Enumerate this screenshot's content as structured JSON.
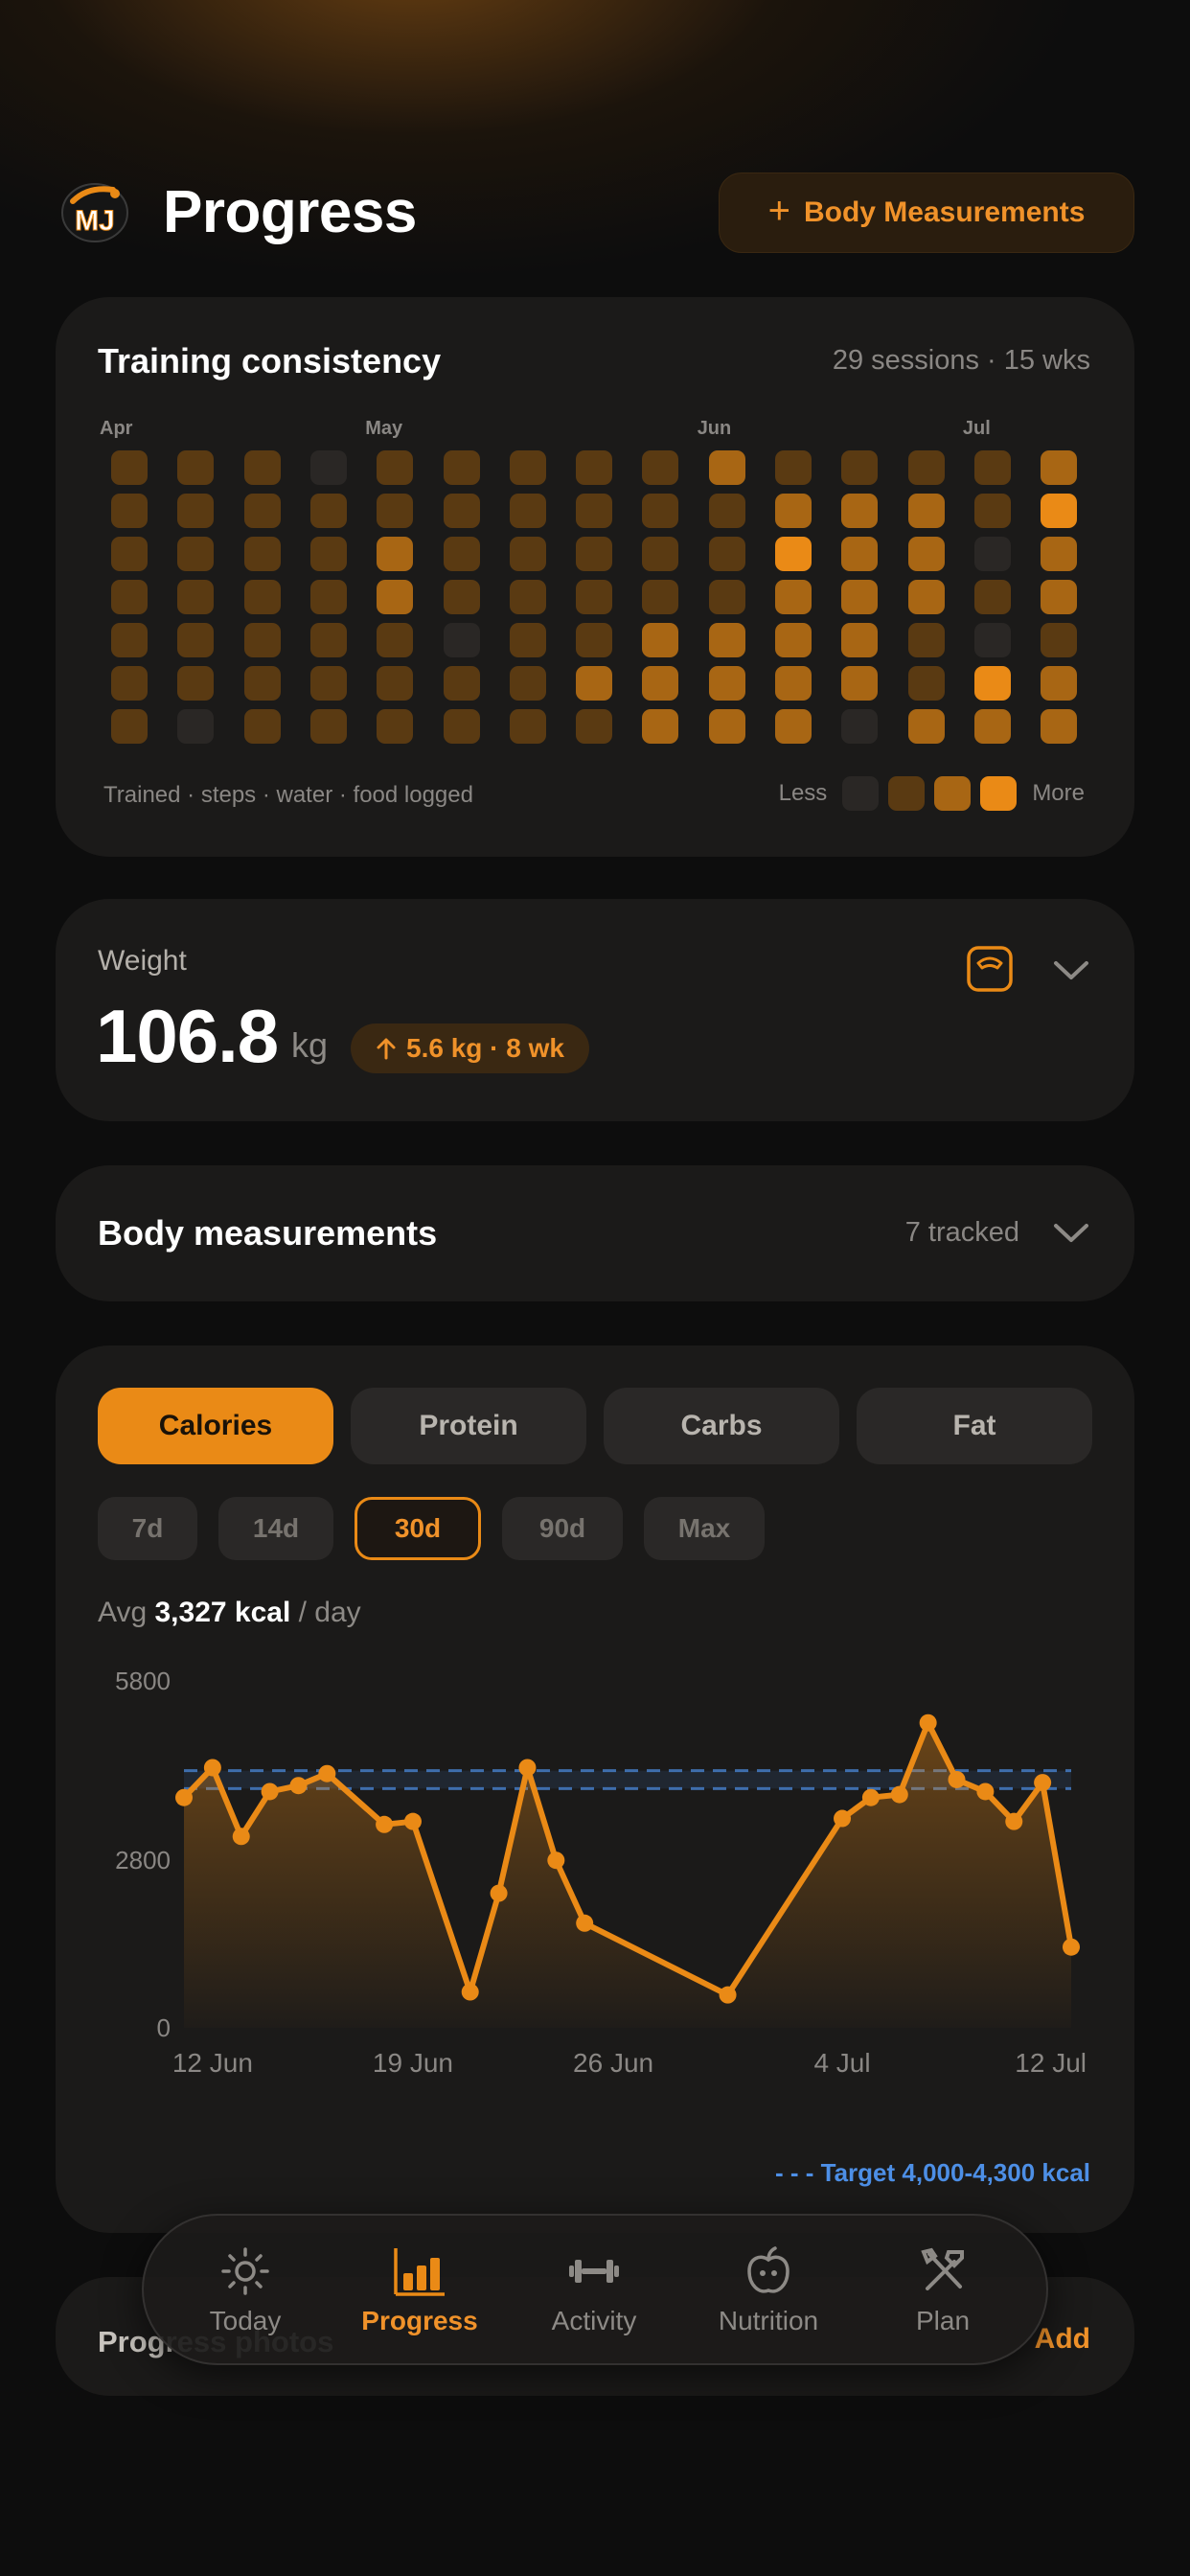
{
  "header": {
    "title": "Progress",
    "add_button_label": "Body Measurements",
    "add_button_icon": "plus-icon",
    "logo_text": "MJ"
  },
  "colors": {
    "accent": "#EA8A16",
    "background": "#0D0D0D",
    "card": "#1B1A19",
    "target_line": "#4D8FE6"
  },
  "training": {
    "title": "Training consistency",
    "meta": "29 sessions · 15 wks",
    "months": [
      {
        "label": "Apr",
        "week": 0
      },
      {
        "label": "May",
        "week": 4
      },
      {
        "label": "Jun",
        "week": 9
      },
      {
        "label": "Jul",
        "week": 13
      }
    ],
    "grid_levels": [
      [
        1,
        1,
        1,
        1,
        1,
        1,
        1
      ],
      [
        1,
        1,
        1,
        1,
        1,
        1,
        0
      ],
      [
        1,
        1,
        1,
        1,
        1,
        1,
        1
      ],
      [
        0,
        1,
        1,
        1,
        1,
        1,
        1
      ],
      [
        1,
        1,
        2,
        2,
        1,
        1,
        1
      ],
      [
        1,
        1,
        1,
        1,
        0,
        1,
        1
      ],
      [
        1,
        1,
        1,
        1,
        1,
        1,
        1
      ],
      [
        1,
        1,
        1,
        1,
        1,
        2,
        1
      ],
      [
        1,
        1,
        1,
        1,
        2,
        2,
        2
      ],
      [
        2,
        1,
        1,
        1,
        2,
        2,
        2
      ],
      [
        1,
        2,
        3,
        2,
        2,
        2,
        2
      ],
      [
        1,
        2,
        2,
        2,
        2,
        2,
        0
      ],
      [
        1,
        2,
        2,
        2,
        1,
        1,
        2
      ],
      [
        1,
        1,
        0,
        1,
        0,
        3,
        2
      ],
      [
        2,
        3,
        2,
        2,
        1,
        2,
        2
      ]
    ],
    "legend_caption": "Trained · steps · water · food logged",
    "legend_less": "Less",
    "legend_more": "More"
  },
  "weight": {
    "label": "Weight",
    "value": "106.8",
    "unit": "kg",
    "change_text": "5.6 kg · 8 wk",
    "change_icon": "arrow-up-icon",
    "scale_icon": "scale-icon",
    "expand_icon": "chevron-down-icon"
  },
  "body_measurements": {
    "title": "Body measurements",
    "meta": "7 tracked",
    "expand_icon": "chevron-down-icon"
  },
  "nutrition": {
    "metric_tabs": [
      "Calories",
      "Protein",
      "Carbs",
      "Fat"
    ],
    "active_metric": "Calories",
    "ranges": [
      "7d",
      "14d",
      "30d",
      "90d",
      "Max"
    ],
    "active_range": "30d",
    "avg_prefix": "Avg",
    "avg_value": "3,327 kcal",
    "avg_suffix": "/ day",
    "target_note": "- - - Target 4,000-4,300 kcal"
  },
  "chart_data": {
    "type": "area",
    "x_unit": "date",
    "y_unit": "kcal",
    "ylim": [
      0,
      5800
    ],
    "yticks": [
      0,
      2800,
      5800
    ],
    "xticks": [
      {
        "label": "12 Jun",
        "date": "2025-06-12"
      },
      {
        "label": "19 Jun",
        "date": "2025-06-19"
      },
      {
        "label": "26 Jun",
        "date": "2025-06-26"
      },
      {
        "label": "4 Jul",
        "date": "2025-07-04"
      },
      {
        "label": "12 Jul",
        "date": "2025-07-12"
      }
    ],
    "target_band": [
      4000,
      4300
    ],
    "series": [
      {
        "points": [
          [
            "2025-06-11",
            3850
          ],
          [
            "2025-06-12",
            4350
          ],
          [
            "2025-06-13",
            3200
          ],
          [
            "2025-06-14",
            3950
          ],
          [
            "2025-06-15",
            4050
          ],
          [
            "2025-06-16",
            4250
          ],
          [
            "2025-06-18",
            3400
          ],
          [
            "2025-06-19",
            3450
          ],
          [
            "2025-06-21",
            600
          ],
          [
            "2025-06-22",
            2250
          ],
          [
            "2025-06-23",
            4350
          ],
          [
            "2025-06-24",
            2800
          ],
          [
            "2025-06-25",
            1750
          ],
          [
            "2025-06-30",
            550
          ],
          [
            "2025-07-04",
            3500
          ],
          [
            "2025-07-05",
            3850
          ],
          [
            "2025-07-06",
            3900
          ],
          [
            "2025-07-07",
            5100
          ],
          [
            "2025-07-08",
            4150
          ],
          [
            "2025-07-09",
            3950
          ],
          [
            "2025-07-10",
            3450
          ],
          [
            "2025-07-11",
            4100
          ],
          [
            "2025-07-12",
            1350
          ]
        ]
      }
    ]
  },
  "next_section": {
    "label": "Progress photos",
    "action": "Add"
  },
  "nav": {
    "items": [
      {
        "label": "Today",
        "icon": "sun-icon"
      },
      {
        "label": "Progress",
        "icon": "bar-chart-icon"
      },
      {
        "label": "Activity",
        "icon": "dumbbell-icon"
      },
      {
        "label": "Nutrition",
        "icon": "apple-icon"
      },
      {
        "label": "Plan",
        "icon": "tools-icon"
      }
    ],
    "active": "Progress"
  }
}
